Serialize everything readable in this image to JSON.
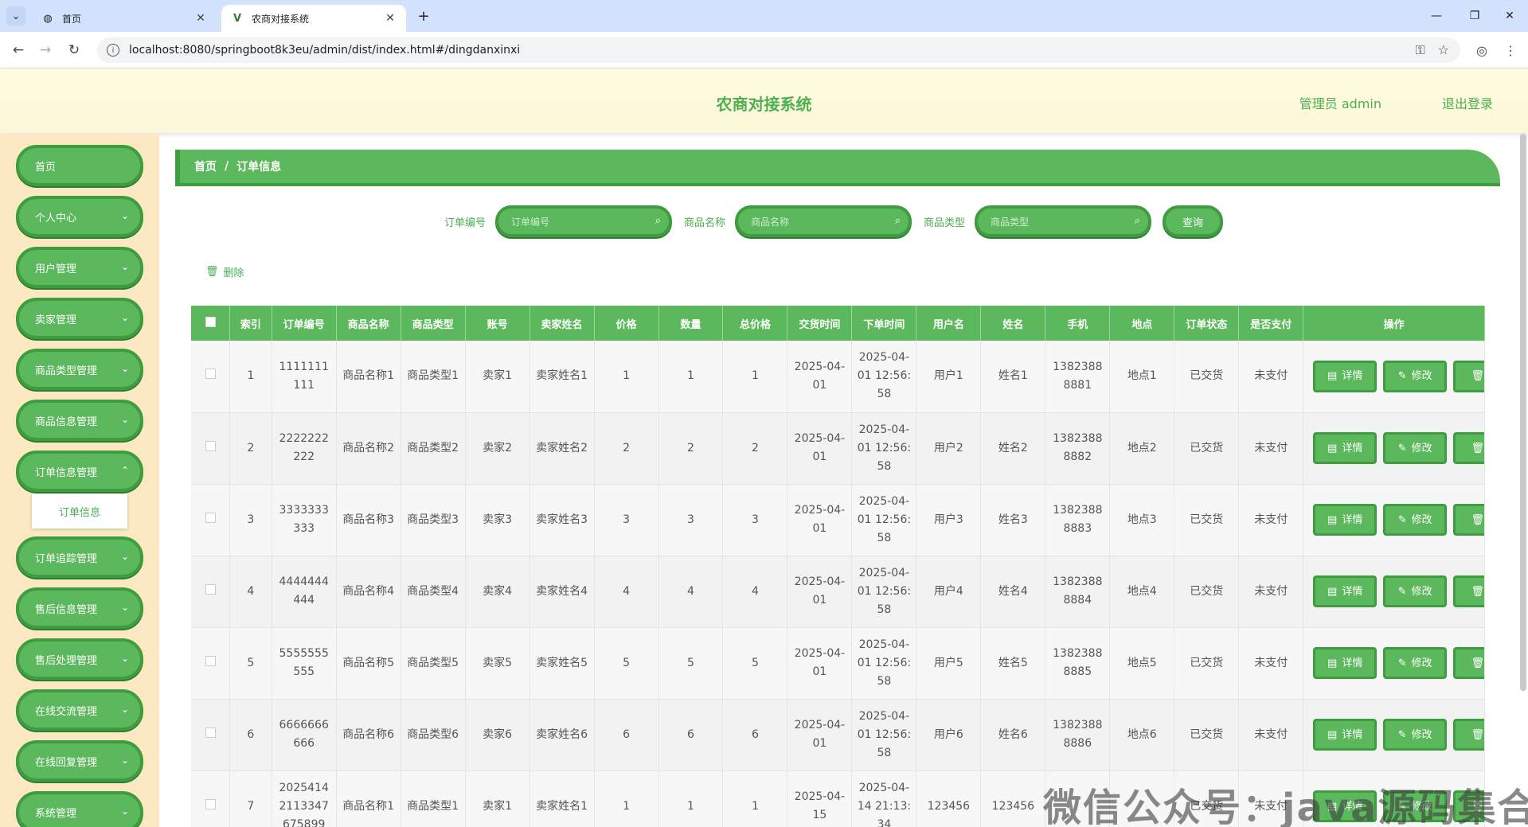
{
  "browser": {
    "tabs": [
      {
        "label": "首页",
        "icon": "globe-icon"
      },
      {
        "label": "农商对接系统",
        "icon": "vue-icon"
      }
    ],
    "url": "localhost:8080/springboot8k3eu/admin/dist/index.html#/dingdanxinxi"
  },
  "header": {
    "title": "农商对接系统",
    "user": "管理员 admin",
    "logout": "退出登录"
  },
  "sidebar": {
    "items": [
      {
        "label": "首页"
      },
      {
        "label": "个人中心"
      },
      {
        "label": "用户管理"
      },
      {
        "label": "卖家管理"
      },
      {
        "label": "商品类型管理"
      },
      {
        "label": "商品信息管理"
      },
      {
        "label": "订单信息管理"
      },
      {
        "label": "订单追踪管理"
      },
      {
        "label": "售后信息管理"
      },
      {
        "label": "售后处理管理"
      },
      {
        "label": "在线交流管理"
      },
      {
        "label": "在线回复管理"
      },
      {
        "label": "系统管理"
      }
    ],
    "submenu": "订单信息"
  },
  "breadcrumb": {
    "home": "首页",
    "sep": "/",
    "current": "订单信息"
  },
  "search": {
    "order_no_label": "订单编号",
    "order_no_placeholder": "订单编号",
    "goods_name_label": "商品名称",
    "goods_name_placeholder": "商品名称",
    "goods_type_label": "商品类型",
    "goods_type_placeholder": "商品类型",
    "query": "查询"
  },
  "actions": {
    "delete": "删除"
  },
  "table": {
    "headers": [
      "索引",
      "订单编号",
      "商品名称",
      "商品类型",
      "账号",
      "卖家姓名",
      "价格",
      "数量",
      "总价格",
      "交货时间",
      "下单时间",
      "用户名",
      "姓名",
      "手机",
      "地点",
      "订单状态",
      "是否支付",
      "操作"
    ],
    "op_labels": {
      "detail": "详情",
      "edit": "修改",
      "delete": "删"
    },
    "rows": [
      [
        "1",
        "1111111111",
        "商品名称1",
        "商品类型1",
        "卖家1",
        "卖家姓名1",
        "1",
        "1",
        "1",
        "2025-04-01",
        "2025-04-01 12:56:58",
        "用户1",
        "姓名1",
        "13823888881",
        "地点1",
        "已交货",
        "未支付"
      ],
      [
        "2",
        "2222222222",
        "商品名称2",
        "商品类型2",
        "卖家2",
        "卖家姓名2",
        "2",
        "2",
        "2",
        "2025-04-01",
        "2025-04-01 12:56:58",
        "用户2",
        "姓名2",
        "13823888882",
        "地点2",
        "已交货",
        "未支付"
      ],
      [
        "3",
        "3333333333",
        "商品名称3",
        "商品类型3",
        "卖家3",
        "卖家姓名3",
        "3",
        "3",
        "3",
        "2025-04-01",
        "2025-04-01 12:56:58",
        "用户3",
        "姓名3",
        "13823888883",
        "地点3",
        "已交货",
        "未支付"
      ],
      [
        "4",
        "4444444444",
        "商品名称4",
        "商品类型4",
        "卖家4",
        "卖家姓名4",
        "4",
        "4",
        "4",
        "2025-04-01",
        "2025-04-01 12:56:58",
        "用户4",
        "姓名4",
        "13823888884",
        "地点4",
        "已交货",
        "未支付"
      ],
      [
        "5",
        "5555555555",
        "商品名称5",
        "商品类型5",
        "卖家5",
        "卖家姓名5",
        "5",
        "5",
        "5",
        "2025-04-01",
        "2025-04-01 12:56:58",
        "用户5",
        "姓名5",
        "13823888885",
        "地点5",
        "已交货",
        "未支付"
      ],
      [
        "6",
        "6666666666",
        "商品名称6",
        "商品类型6",
        "卖家6",
        "卖家姓名6",
        "6",
        "6",
        "6",
        "2025-04-01",
        "2025-04-01 12:56:58",
        "用户6",
        "姓名6",
        "13823888886",
        "地点6",
        "已交货",
        "未支付"
      ],
      [
        "7",
        "20254142113347675899",
        "商品名称1",
        "商品类型1",
        "卖家1",
        "卖家姓名1",
        "1",
        "1",
        "1",
        "2025-04-15",
        "2025-04-14 21:13:34",
        "123456",
        "123456",
        "",
        "",
        "已交货",
        "未支付"
      ]
    ]
  },
  "watermark": "微信公众号：java源码集合"
}
